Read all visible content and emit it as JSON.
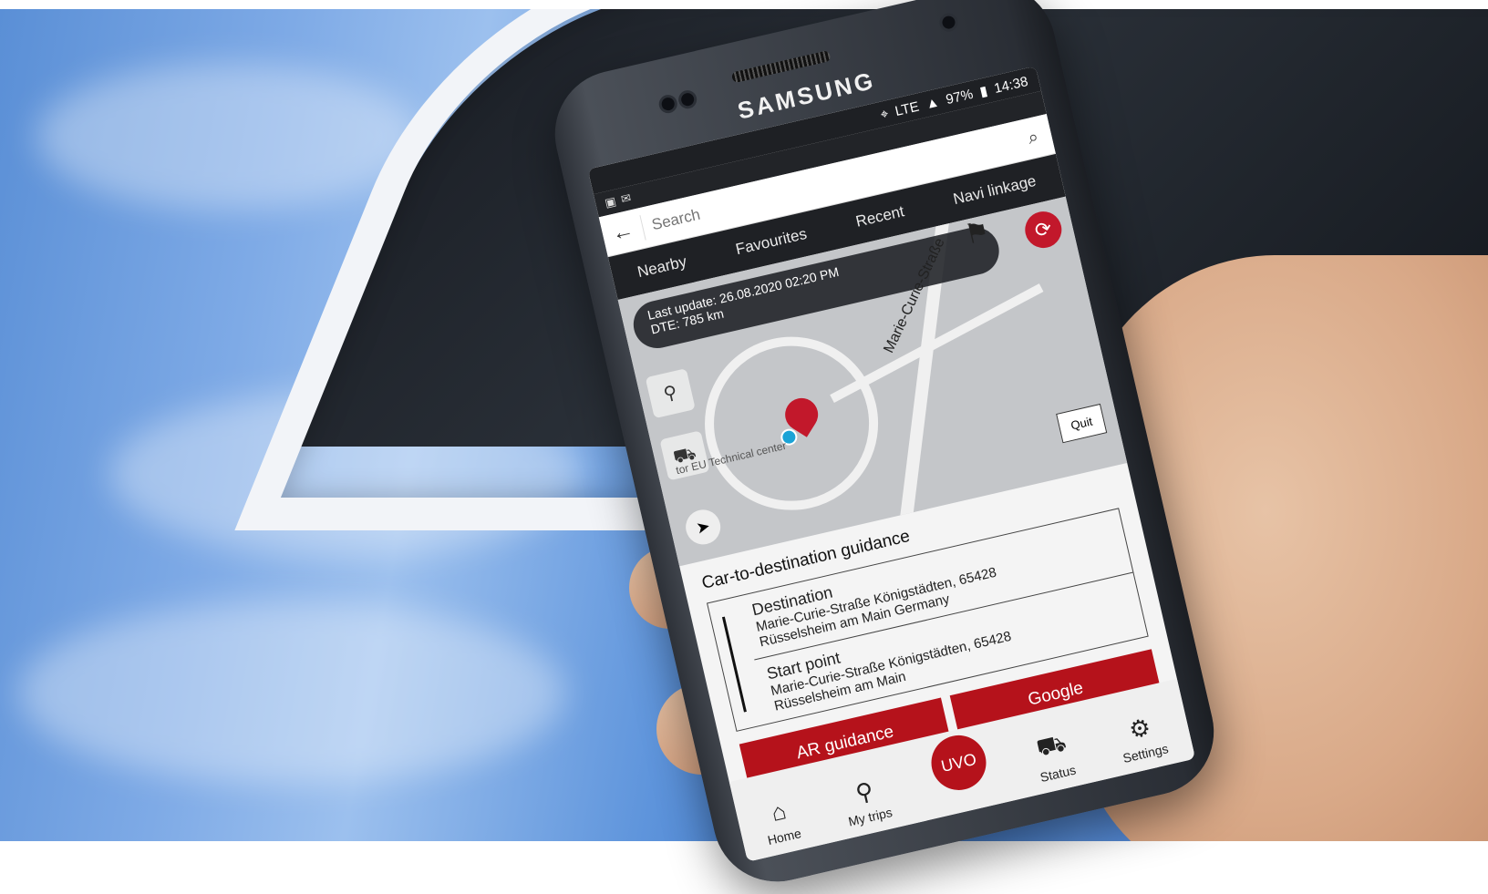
{
  "device": {
    "brand": "SAMSUNG"
  },
  "statusbar": {
    "network": "LTE",
    "battery": "97%",
    "time": "14:38"
  },
  "search": {
    "placeholder": "Search"
  },
  "tabs": [
    {
      "label": "Nearby"
    },
    {
      "label": "Favourites"
    },
    {
      "label": "Recent"
    },
    {
      "label": "Navi linkage"
    }
  ],
  "map": {
    "last_update": "Last update: 26.08.2020 02:20 PM",
    "dte": "DTE: 785 km",
    "street": "Marie-Curie-Straße",
    "poi": "tor EU Technical center",
    "quit_label": "Quit"
  },
  "guidance": {
    "title": "Car-to-destination guidance",
    "destination_label": "Destination",
    "destination_line1": "Marie-Curie-Straße Königstädten, 65428",
    "destination_line2": "Rüsselsheim am Main Germany",
    "start_label": "Start point",
    "start_line1": "Marie-Curie-Straße Königstädten, 65428",
    "start_line2": "Rüsselsheim am Main",
    "ar_button": "AR guidance",
    "google_button": "Google"
  },
  "bottomnav": {
    "home": "Home",
    "my_trips": "My trips",
    "uvo": "UVO",
    "status": "Status",
    "settings": "Settings"
  },
  "colors": {
    "accent": "#b5121b",
    "refresh": "#c2182b",
    "location_dot": "#1ba3d6"
  }
}
